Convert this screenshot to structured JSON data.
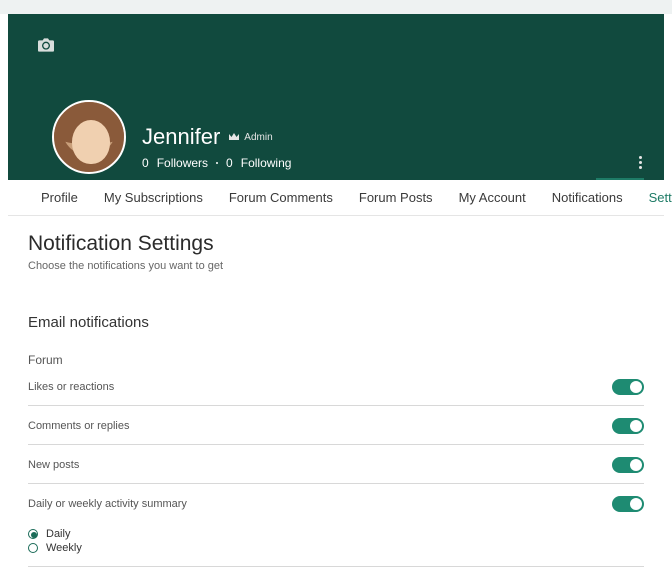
{
  "profile": {
    "username": "Jennifer",
    "badge_label": "Admin",
    "followers_count": "0",
    "followers_label": "Followers",
    "following_count": "0",
    "following_label": "Following"
  },
  "tabs": {
    "profile": "Profile",
    "subscriptions": "My Subscriptions",
    "forum_comments": "Forum Comments",
    "forum_posts": "Forum Posts",
    "my_account": "My Account",
    "notifications": "Notifications",
    "settings": "Settings"
  },
  "page": {
    "title": "Notification Settings",
    "description": "Choose the notifications you want to get"
  },
  "section": {
    "email": "Email notifications",
    "forum": "Forum"
  },
  "settings": {
    "likes": "Likes or reactions",
    "comments": "Comments or replies",
    "newposts": "New posts",
    "summary": "Daily or weekly activity summary"
  },
  "radios": {
    "daily": "Daily",
    "weekly": "Weekly"
  },
  "colors": {
    "brand_bg": "#114a3e",
    "accent": "#1e8b72"
  }
}
